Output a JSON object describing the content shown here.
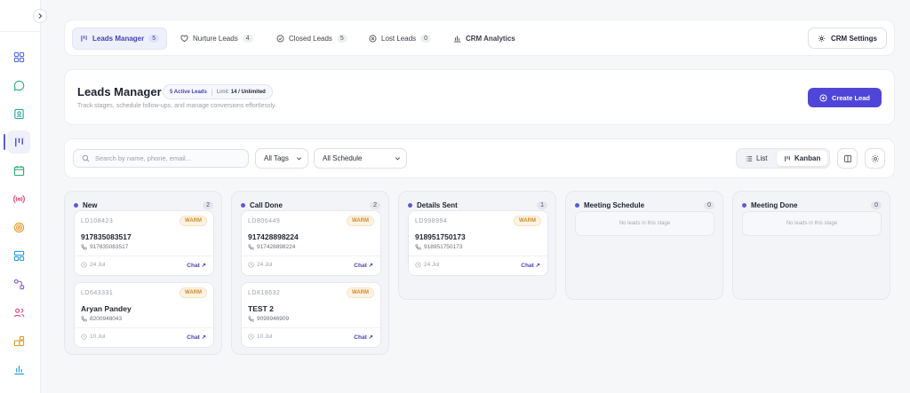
{
  "tabs": [
    {
      "label": "Leads Manager",
      "count": "5",
      "icon": "kanban-icon"
    },
    {
      "label": "Nurture Leads",
      "count": "4",
      "icon": "heart-icon"
    },
    {
      "label": "Closed Leads",
      "count": "5",
      "icon": "check-circle-icon"
    },
    {
      "label": "Lost Leads",
      "count": "0",
      "icon": "x-circle-icon"
    },
    {
      "label": "CRM Analytics",
      "icon": "bar-chart-icon"
    }
  ],
  "crm_settings_label": "CRM Settings",
  "header": {
    "title": "Leads Manager",
    "active_leads": "5 Active Leads",
    "limit_label": "Limit:",
    "limit_value": "14 / Unlimited",
    "subtitle": "Track stages, schedule follow-ups, and manage conversions effortlessly.",
    "create_label": "Create Lead"
  },
  "filters": {
    "search_placeholder": "Search by name, phone, email...",
    "tags_value": "All Tags",
    "schedule_value": "All Schedule",
    "view_list": "List",
    "view_kanban": "Kanban"
  },
  "columns": [
    {
      "title": "New",
      "count": "2",
      "cards": [
        {
          "id": "LD108423",
          "badge": "WARM",
          "name": "917835083517",
          "phone": "917835083517",
          "date": "24 Jul",
          "action": "Chat ↗"
        },
        {
          "id": "LD643331",
          "badge": "WARM",
          "name": "Aryan Pandey",
          "phone": "8200948043",
          "date": "10 Jul",
          "action": "Chat ↗"
        }
      ]
    },
    {
      "title": "Call Done",
      "count": "2",
      "cards": [
        {
          "id": "LD806449",
          "badge": "WARM",
          "name": "917428898224",
          "phone": "917428898224",
          "date": "24 Jul",
          "action": "Chat ↗"
        },
        {
          "id": "LD818632",
          "badge": "WARM",
          "name": "TEST 2",
          "phone": "9099946909",
          "date": "10 Jul",
          "action": "Chat ↗"
        }
      ]
    },
    {
      "title": "Details Sent",
      "count": "1",
      "cards": [
        {
          "id": "LD998994",
          "badge": "WARM",
          "name": "918951750173",
          "phone": "918951750173",
          "date": "24 Jul",
          "action": "Chat ↗"
        }
      ]
    },
    {
      "title": "Meeting Schedule",
      "count": "0",
      "empty": "No leads in this stage"
    },
    {
      "title": "Meeting Done",
      "count": "0",
      "empty": "No leads in this stage"
    }
  ],
  "sidebar_icons": [
    "dashboard-icon",
    "chat-icon",
    "contacts-icon",
    "kanban-icon",
    "calendar-icon",
    "broadcast-icon",
    "target-icon",
    "layout-icon",
    "workflow-icon",
    "users-icon",
    "apps-icon",
    "analytics-icon"
  ],
  "colors": {
    "accent": "#4f46d8",
    "warm": "#d08a2a",
    "sidebar_icon": "#e0457b"
  }
}
